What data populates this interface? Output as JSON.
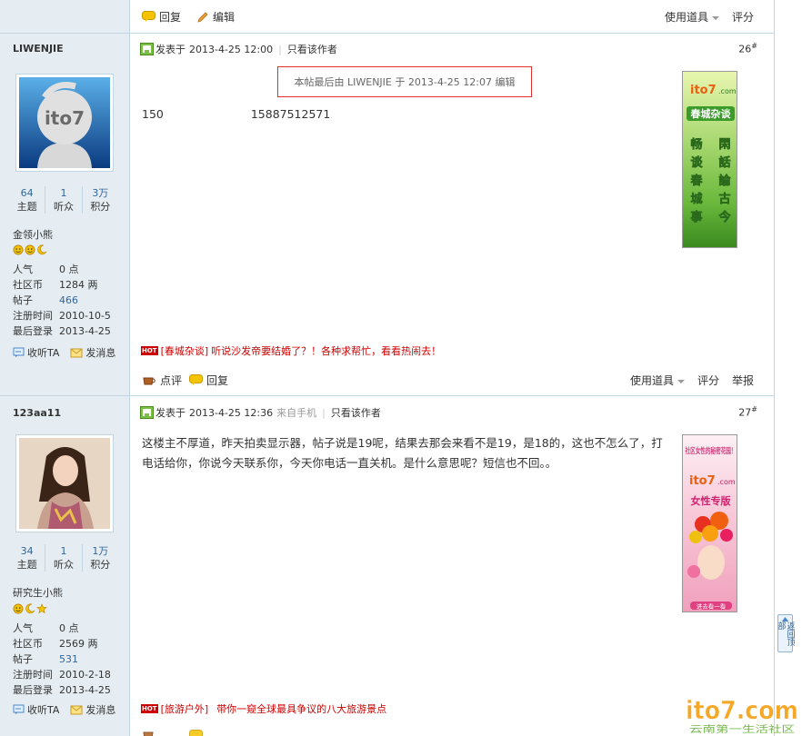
{
  "top_bar": {
    "reply": "回复",
    "edit": "编辑",
    "tools": "使用道具",
    "rate": "评分"
  },
  "posts": [
    {
      "author": "LIWENJIE",
      "avatar_icon": "ito7-logo-avatar",
      "stats": [
        {
          "num": "64",
          "label": "主题"
        },
        {
          "num": "1",
          "label": "听众"
        },
        {
          "num": "3万",
          "label": "积分"
        }
      ],
      "rank": "金领小熊",
      "info": [
        {
          "k": "人气",
          "v": "0 点"
        },
        {
          "k": "社区币",
          "v": "1284 两"
        },
        {
          "k": "帖子",
          "v": "466"
        },
        {
          "k": "注册时间",
          "v": "2010-10-5"
        },
        {
          "k": "最后登录",
          "v": "2013-4-25"
        }
      ],
      "follow": "收听TA",
      "message": "发消息",
      "posted_label": "发表于",
      "posted_time": "2013-4-25 12:00",
      "mobile": "",
      "only_author": "只看该作者",
      "floor": "26",
      "floor_mark": "#",
      "edit_note": "本帖最后由  LIWENJIE 于  2013-4-25 12:07 编辑",
      "content_a": "150",
      "content_b": "15887512571",
      "ad_tag": "[春城杂谈]",
      "ad_text": "听说沙发帝要结婚了？！各种求帮忙，看看热闹去！",
      "footer": {
        "comment": "点评",
        "reply": "回复",
        "tools": "使用道具",
        "rate": "评分",
        "report": "举报"
      },
      "banner": {
        "brand": "ito7",
        "domain": ".com",
        "title": "春城杂谈",
        "col_left": [
          "畅",
          "谈",
          "春",
          "城",
          "事"
        ],
        "col_right": [
          "閑",
          "話",
          "論",
          "古",
          "今"
        ]
      }
    },
    {
      "author": "123aa11",
      "avatar_icon": "user-photo-avatar",
      "stats": [
        {
          "num": "34",
          "label": "主题"
        },
        {
          "num": "1",
          "label": "听众"
        },
        {
          "num": "1万",
          "label": "积分"
        }
      ],
      "rank": "研究生小熊",
      "info": [
        {
          "k": "人气",
          "v": "0 点"
        },
        {
          "k": "社区币",
          "v": "2569 两"
        },
        {
          "k": "帖子",
          "v": "531"
        },
        {
          "k": "注册时间",
          "v": "2010-2-18"
        },
        {
          "k": "最后登录",
          "v": "2013-4-25"
        }
      ],
      "follow": "收听TA",
      "message": "发消息",
      "posted_label": "发表于",
      "posted_time": "2013-4-25 12:36",
      "mobile": "来自手机",
      "only_author": "只看该作者",
      "floor": "27",
      "floor_mark": "#",
      "content": "这楼主不厚道，昨天拍卖显示器，帖子说是19呢，结果去那会来看不是19，是18的，这也不怎么了，打电话给你，你说今天联系你，今天你电话一直关机。是什么意思呢？短信也不回。。",
      "ad_tag": "[旅游户外]",
      "ad_text": "带你一窥全球最具争议的八大旅游景点",
      "banner": {
        "tagline": "社区女性的秘密花园！",
        "brand": "ito7",
        "domain": ".com",
        "title": "女性专版",
        "button": "进去看一看"
      }
    }
  ],
  "back_top": "返回顶部",
  "watermark": {
    "brand": "ito7.com",
    "slogan": "云南第一生活社区"
  },
  "colors": {
    "border": "#c2d5e3",
    "sidebar": "#e5edf2",
    "link": "#336699",
    "accent_red": "#cc0000"
  }
}
